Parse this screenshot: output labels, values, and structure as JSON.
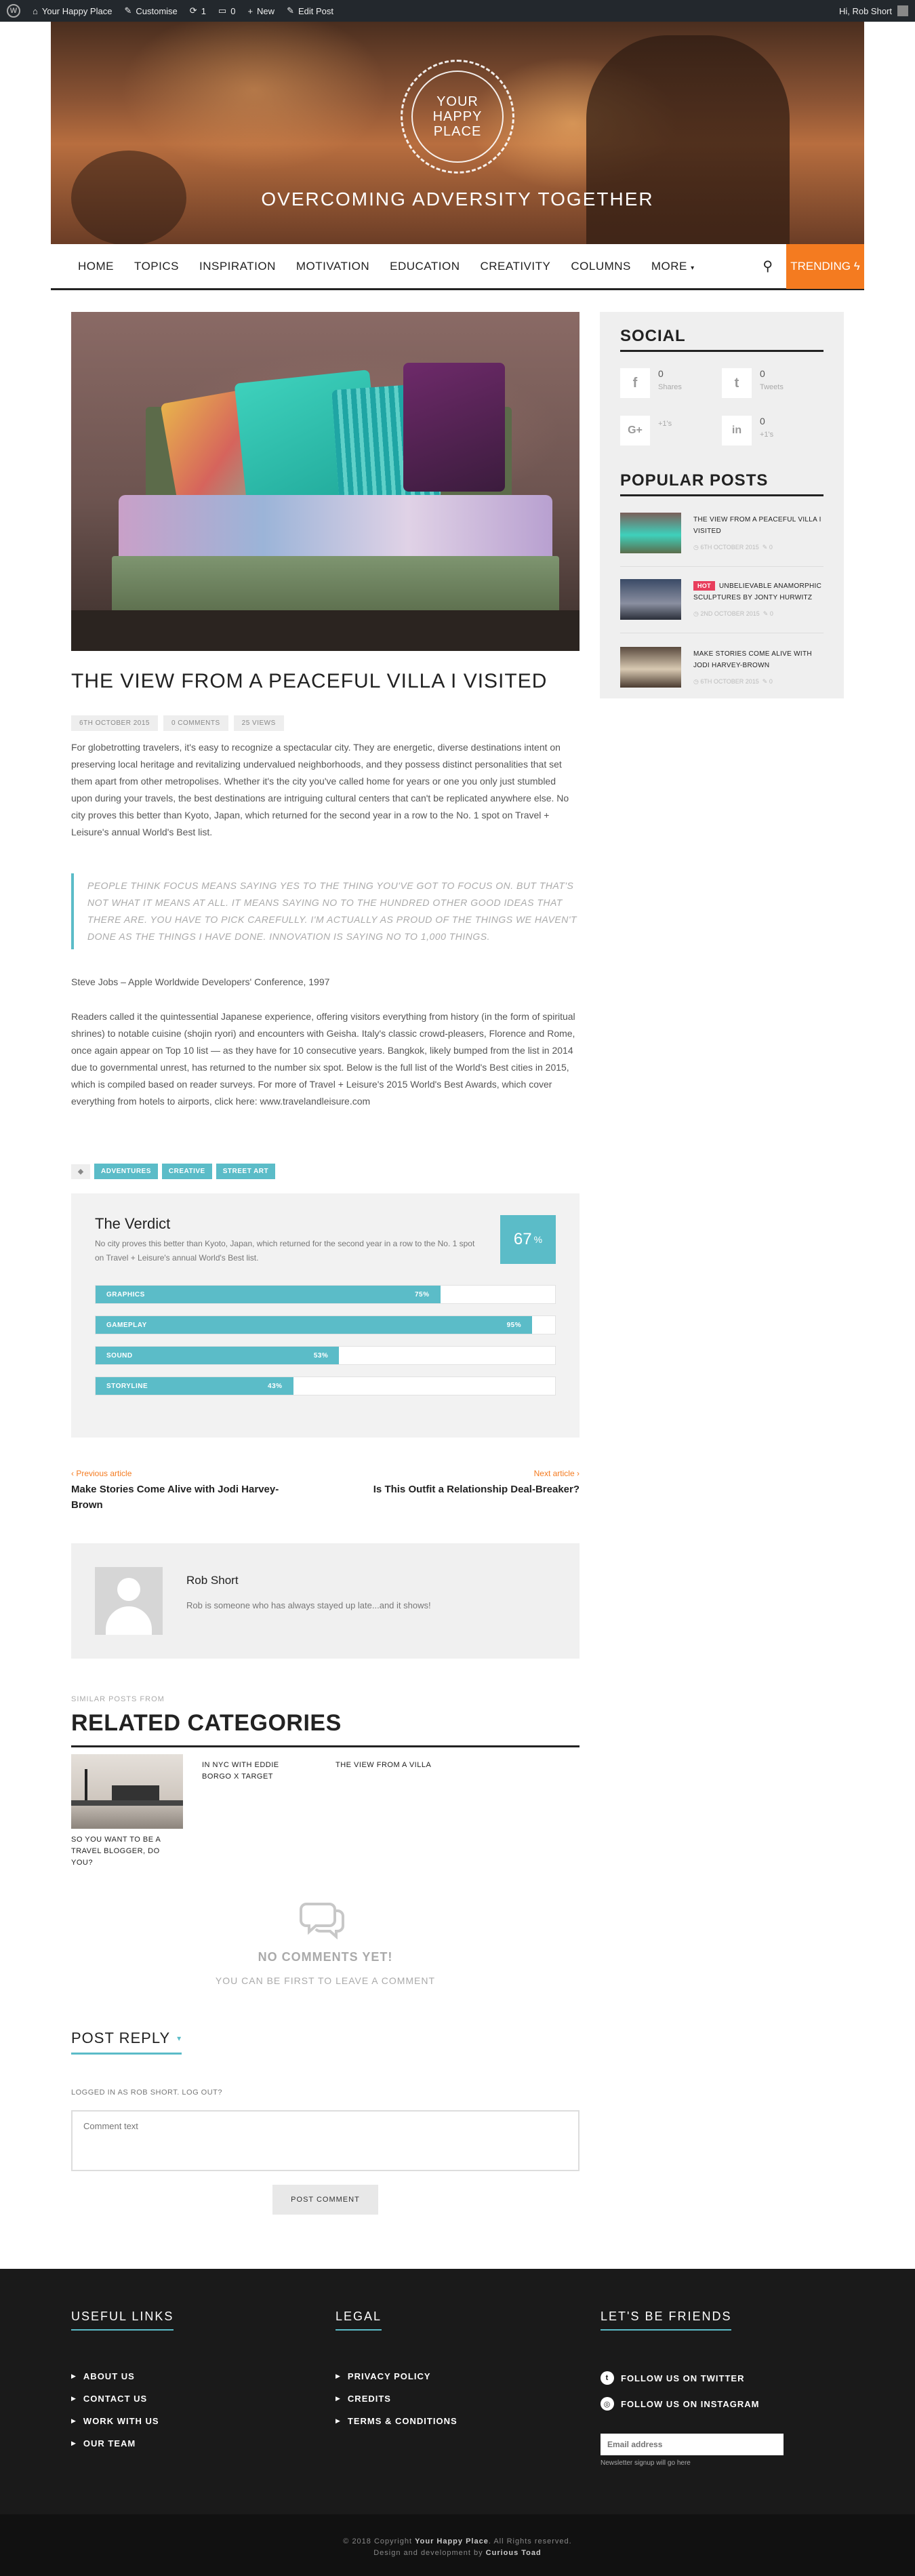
{
  "adminbar": {
    "site_name": "Your Happy Place",
    "customise": "Customise",
    "updates": "1",
    "comments": "0",
    "new": "New",
    "edit_post": "Edit Post",
    "greeting": "Hi, Rob Short"
  },
  "header": {
    "logo_lines": [
      "YOUR",
      "HAPPY",
      "PLACE"
    ],
    "tagline": "OVERCOMING ADVERSITY TOGETHER"
  },
  "nav": {
    "items": [
      "HOME",
      "TOPICS",
      "INSPIRATION",
      "MOTIVATION",
      "EDUCATION",
      "CREATIVITY",
      "COLUMNS",
      "MORE"
    ],
    "trending": "TRENDING"
  },
  "post": {
    "title": "THE VIEW FROM A PEACEFUL VILLA I VISITED",
    "meta": [
      "6TH OCTOBER 2015",
      "0 COMMENTS",
      "25 VIEWS"
    ],
    "para1": "For globetrotting travelers, it's easy to recognize a spectacular city. They are energetic, diverse destinations intent on preserving local heritage and revitalizing undervalued neighborhoods, and they possess distinct personalities that set them apart from other metropolises. Whether it's the city you've called home for years or one you only just stumbled upon during your travels, the best destinations are intriguing cultural centers that can't be replicated anywhere else. No city proves this better than Kyoto, Japan, which returned for the second year in a row to the No. 1 spot on Travel + Leisure's annual World's Best list.",
    "quote": "PEOPLE THINK FOCUS MEANS SAYING YES TO THE THING YOU'VE GOT TO FOCUS ON. BUT THAT'S NOT WHAT IT MEANS AT ALL. IT MEANS SAYING NO TO THE HUNDRED OTHER GOOD IDEAS THAT THERE ARE. YOU HAVE TO PICK CAREFULLY. I'M ACTUALLY AS PROUD OF THE THINGS WE HAVEN'T DONE AS THE THINGS I HAVE DONE. INNOVATION IS SAYING NO TO 1,000 THINGS.",
    "attribution": "Steve Jobs – Apple Worldwide Developers' Conference, 1997",
    "para2": "Readers called it the quintessential Japanese experience, offering visitors everything from history (in the form of spiritual shrines) to notable cuisine (shojin ryori) and encounters with Geisha. Italy's classic crowd-pleasers, Florence and Rome, once again appear on Top 10 list — as they have for 10 consecutive years. Bangkok, likely bumped from the list in 2014 due to governmental unrest, has returned to the number six spot. Below is the full list of the World's Best cities in 2015, which is compiled based on reader surveys. For more of Travel + Leisure's 2015 World's Best Awards, which cover everything from hotels to airports, click here: www.travelandleisure.com",
    "tags": [
      "ADVENTURES",
      "CREATIVE",
      "STREET ART"
    ]
  },
  "verdict": {
    "title": "The Verdict",
    "description": "No city proves this better than Kyoto, Japan, which returned for the second year in a row to the No. 1 spot on Travel + Leisure's annual World's Best list.",
    "score": "67",
    "score_unit": "%",
    "bars": [
      {
        "label": "GRAPHICS",
        "value": "75%",
        "fraction": 0.75
      },
      {
        "label": "GAMEPLAY",
        "value": "95%",
        "fraction": 0.95
      },
      {
        "label": "SOUND",
        "value": "53%",
        "fraction": 0.53
      },
      {
        "label": "STORYLINE",
        "value": "43%",
        "fraction": 0.43
      }
    ]
  },
  "postnav": {
    "prev_label": "Previous article",
    "prev_title": "Make Stories Come Alive with Jodi Harvey-Brown",
    "next_label": "Next article",
    "next_title": "Is This Outfit a Relationship Deal-Breaker?"
  },
  "author": {
    "name": "Rob Short",
    "bio": "Rob is someone who has always stayed up late...and it shows!"
  },
  "related": {
    "kicker": "SIMILAR POSTS FROM",
    "title": "RELATED CATEGORIES",
    "items": [
      "SO YOU WANT TO BE A TRAVEL BLOGGER, DO YOU?",
      "IN NYC WITH EDDIE BORGO X TARGET",
      "THE VIEW FROM A VILLA"
    ]
  },
  "comments": {
    "none": "NO COMMENTS YET!",
    "be_first": "YOU CAN BE FIRST TO LEAVE A COMMENT",
    "post_reply": "POST REPLY",
    "logged_in": "LOGGED IN AS ROB SHORT. LOG OUT?",
    "placeholder": "Comment text",
    "submit": "POST COMMENT"
  },
  "sidebar": {
    "social_title": "SOCIAL",
    "social": [
      {
        "icon": "facebook-icon",
        "glyph": "f",
        "count": "0",
        "label": "Shares"
      },
      {
        "icon": "twitter-icon",
        "glyph": "t",
        "count": "0",
        "label": "Tweets"
      },
      {
        "icon": "google-plus-icon",
        "glyph": "G+",
        "count": "",
        "label": "+1's"
      },
      {
        "icon": "linkedin-icon",
        "glyph": "in",
        "count": "0",
        "label": "+1's"
      }
    ],
    "popular_title": "POPULAR POSTS",
    "popular": [
      {
        "title": "THE VIEW FROM A PEACEFUL VILLA I VISITED",
        "date": "6TH OCTOBER 2015",
        "comments": "0",
        "hot": ""
      },
      {
        "title": "UNBELIEVABLE ANAMORPHIC SCULPTURES BY JONTY HURWITZ",
        "date": "2ND OCTOBER 2015",
        "comments": "0",
        "hot": "HOT"
      },
      {
        "title": "MAKE STORIES COME ALIVE WITH JODI HARVEY-BROWN",
        "date": "6TH OCTOBER 2015",
        "comments": "0",
        "hot": ""
      }
    ]
  },
  "footer": {
    "useful_title": "USEFUL LINKS",
    "useful": [
      "ABOUT US",
      "CONTACT US",
      "WORK WITH US",
      "OUR TEAM"
    ],
    "legal_title": "LEGAL",
    "legal": [
      "PRIVACY POLICY",
      "CREDITS",
      "TERMS & CONDITIONS"
    ],
    "friends_title": "LET'S BE FRIENDS",
    "friends": [
      "FOLLOW US ON TWITTER",
      "FOLLOW US ON INSTAGRAM"
    ],
    "email_placeholder": "Email address",
    "newsletter_note": "Newsletter signup will go here",
    "copyright_prefix": "© 2018 Copyright",
    "copyright_site": "Your Happy Place",
    "copyright_suffix": ". All Rights reserved.",
    "credit_prefix": "Design and development by",
    "credit_name": "Curious Toad"
  },
  "colors": {
    "accent": "#5bbcc8",
    "orange": "#f47b20",
    "hot": "#e83e5c"
  }
}
